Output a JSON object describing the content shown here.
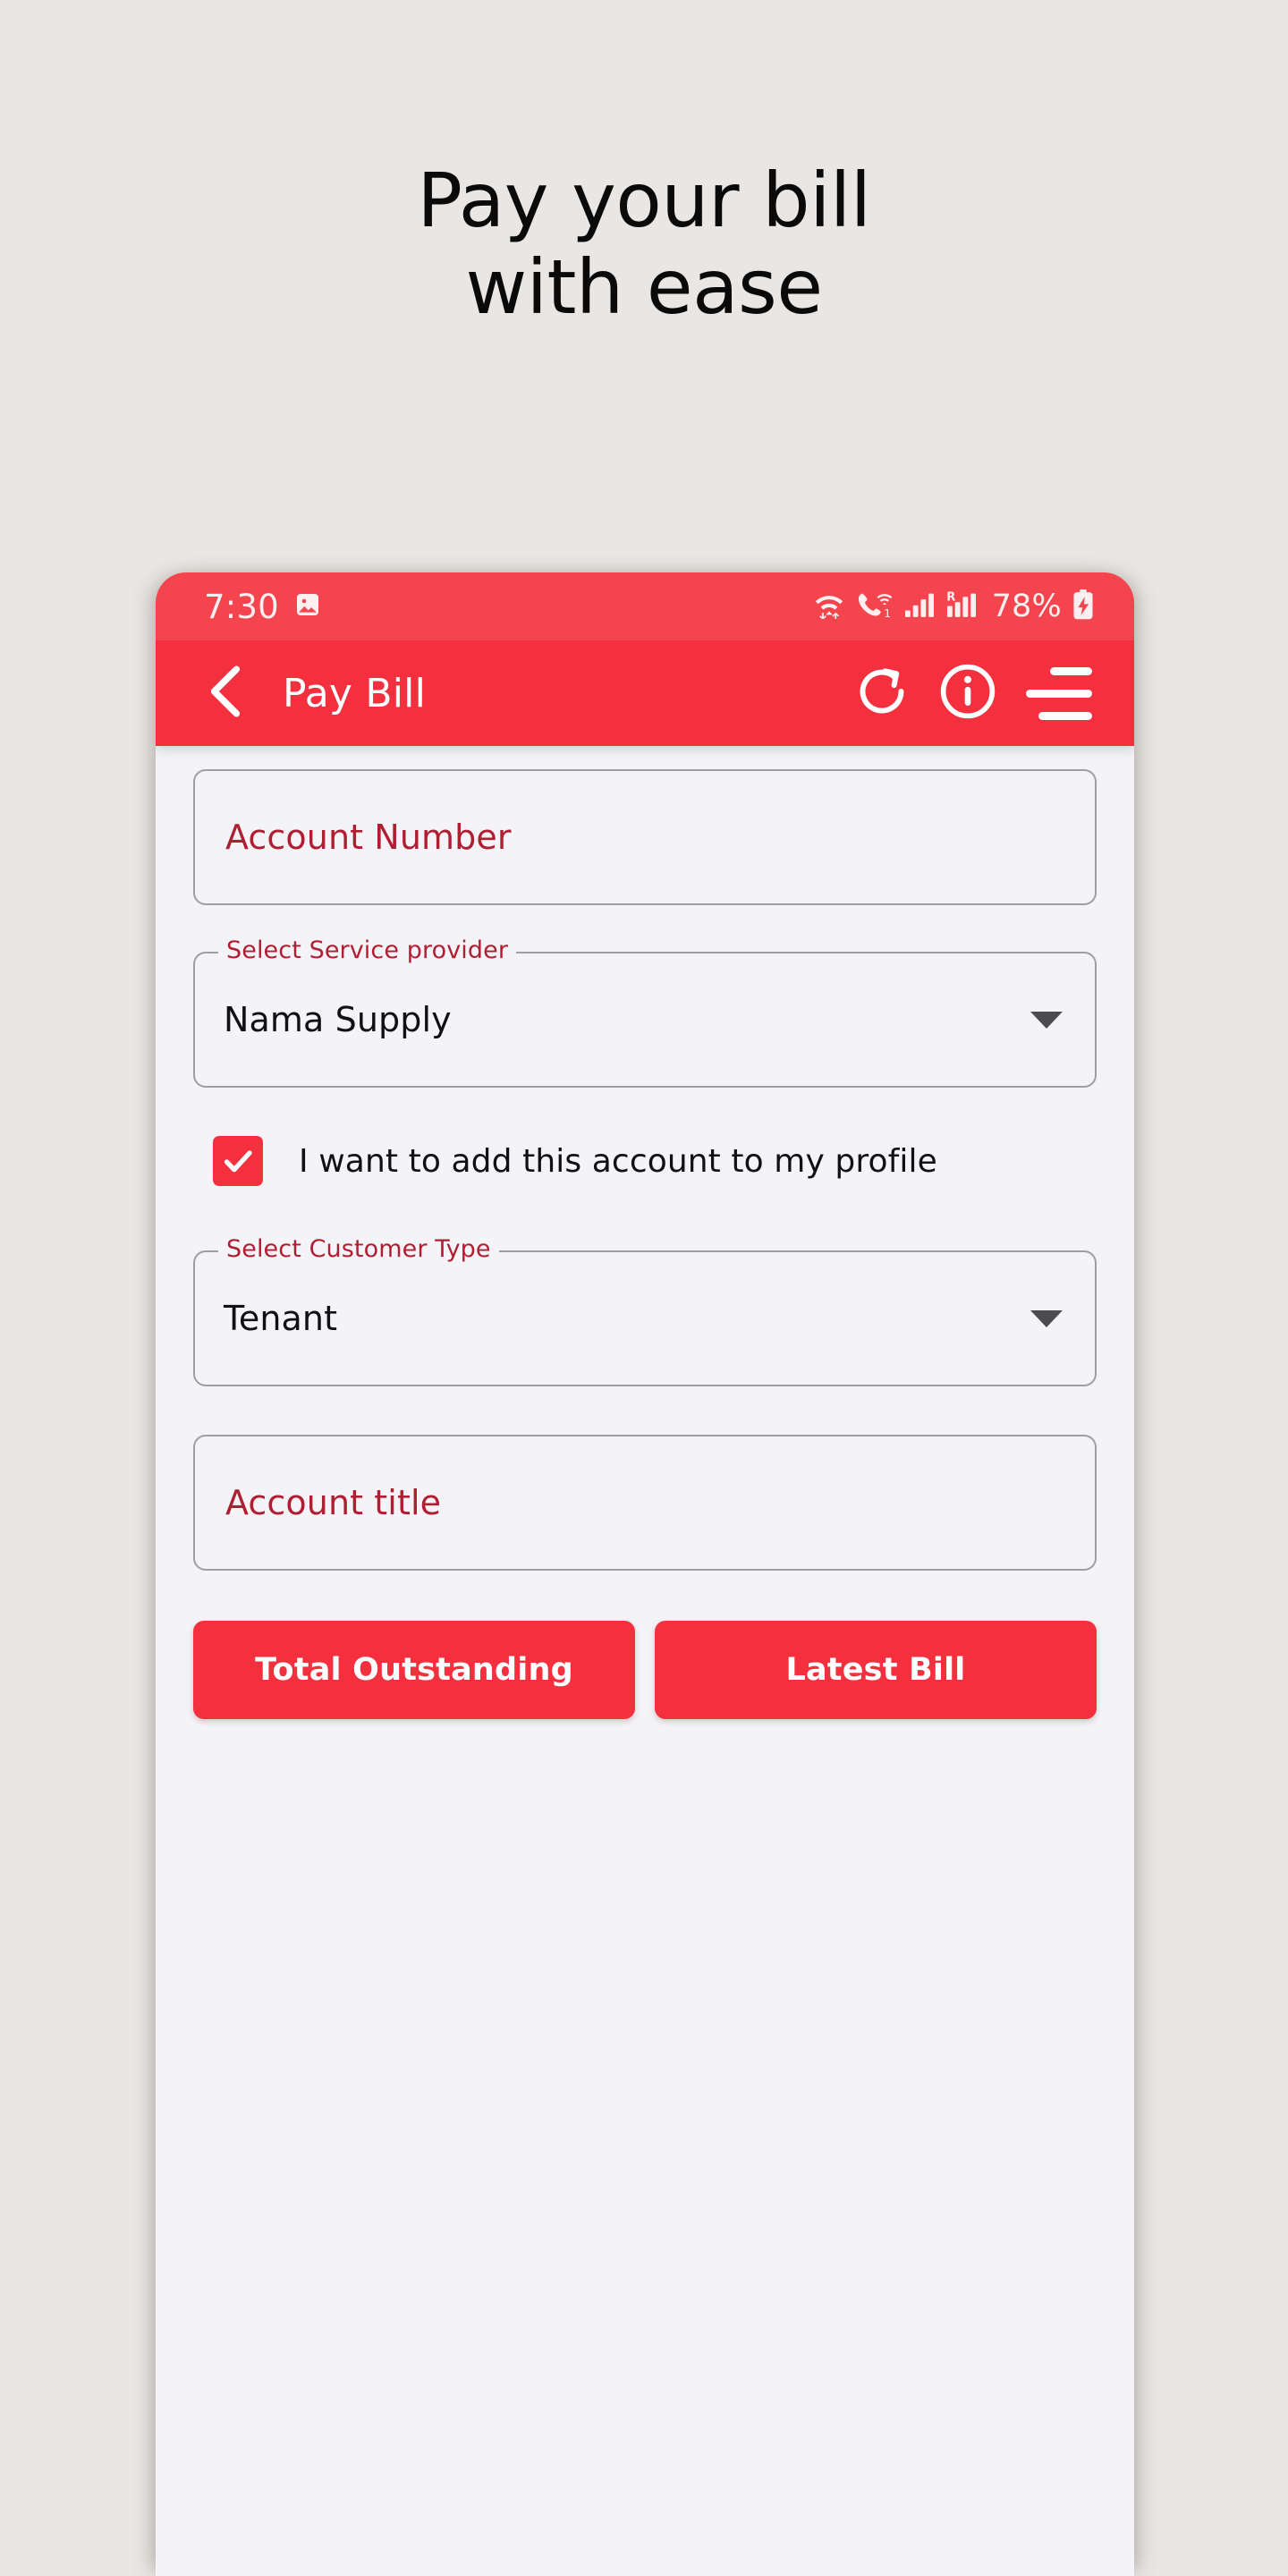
{
  "promo": {
    "line1": "Pay your bill",
    "line2": "with ease"
  },
  "colors": {
    "brand_red": "#F4303F",
    "status_red": "#F4454F",
    "page_background": "#E9E6E3",
    "screen_background": "#F4F4F8",
    "label_red": "#B01E32",
    "field_border": "#9E9EA3"
  },
  "statusbar": {
    "time": "7:30",
    "photo_icon": "image-icon",
    "wifi_icon": "wifi-data-icon",
    "wifi_calling_icon": "wifi-calling-icon",
    "signal_icon": "signal-bars-icon",
    "roaming_icon": "roaming-signal-icon",
    "battery_percent": "78%",
    "battery_icon": "battery-charging-icon"
  },
  "appbar": {
    "back_icon": "back-chevron-icon",
    "title": "Pay Bill",
    "refresh_icon": "refresh-icon",
    "info_icon": "info-icon",
    "menu_icon": "hamburger-menu-icon"
  },
  "form": {
    "account_number": {
      "placeholder": "Account Number",
      "value": ""
    },
    "service_provider": {
      "label": "Select Service provider",
      "value": "Nama Supply"
    },
    "add_to_profile": {
      "label": "I want to add this account to my profile",
      "checked": true
    },
    "customer_type": {
      "label": "Select Customer Type",
      "value": "Tenant"
    },
    "account_title": {
      "placeholder": "Account title",
      "value": ""
    },
    "buttons": {
      "total_outstanding": "Total Outstanding",
      "latest_bill": "Latest Bill"
    }
  }
}
